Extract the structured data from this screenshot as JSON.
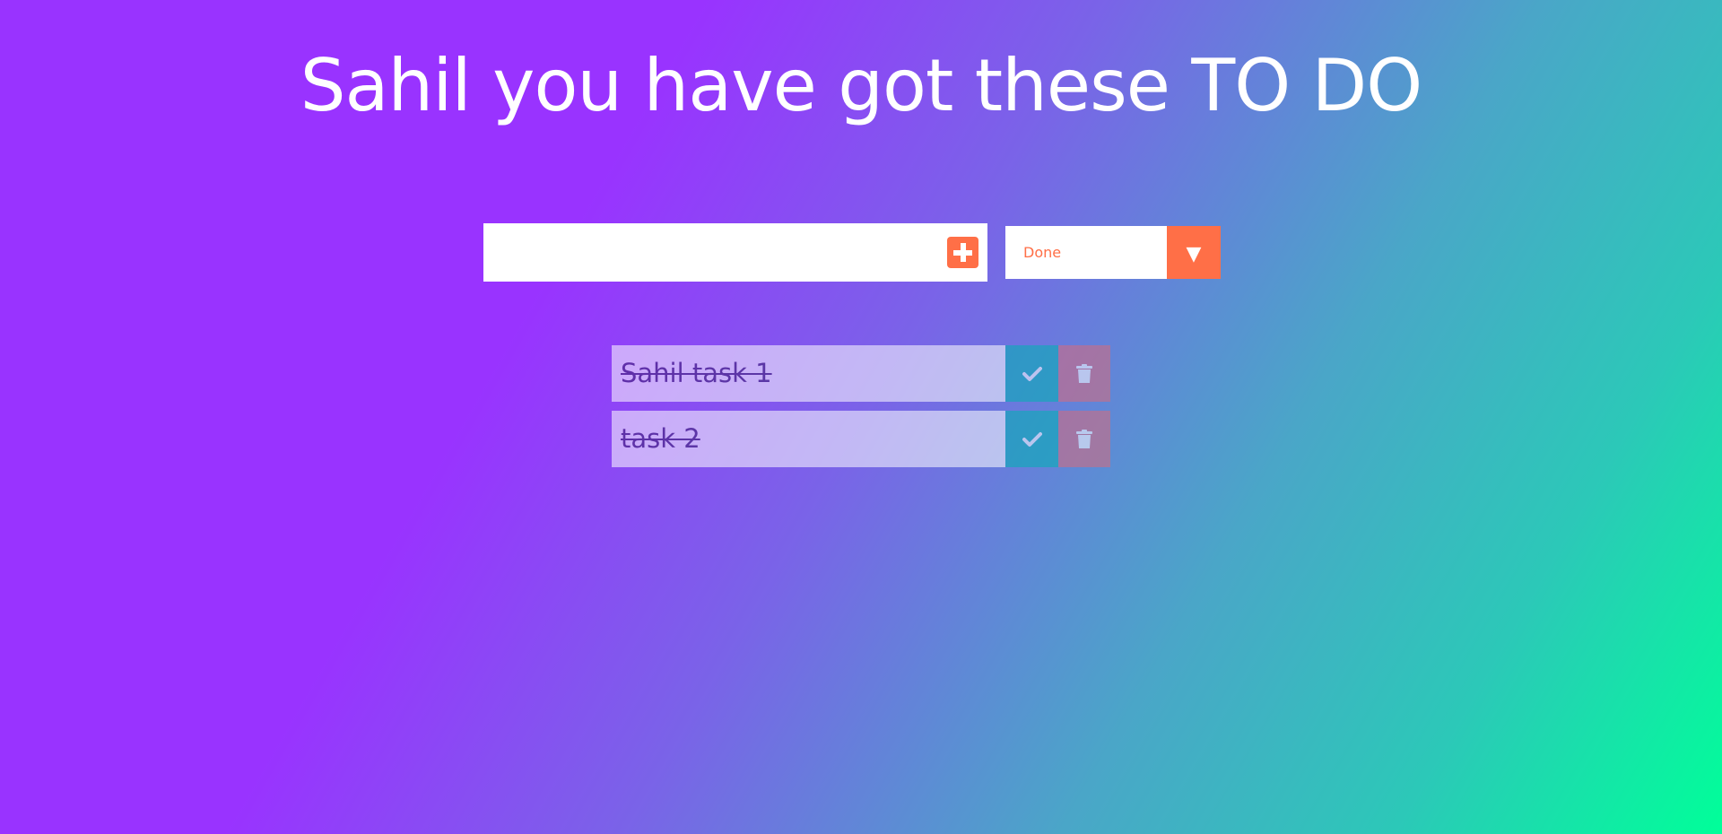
{
  "header": {
    "title": "Sahil you have got these TO DO"
  },
  "form": {
    "input_value": "",
    "add_icon": "plus-square-icon",
    "filter": {
      "selected": "Done",
      "arrow_glyph": "▼"
    }
  },
  "todos": [
    {
      "text": "Sahil task 1",
      "completed": true
    },
    {
      "text": "task 2",
      "completed": true
    }
  ],
  "colors": {
    "accent": "#ff6f47",
    "complete": "#00b3b3",
    "trash": "#d86b7a",
    "gradient_start": "#9933ff",
    "gradient_end": "#00ff99"
  }
}
